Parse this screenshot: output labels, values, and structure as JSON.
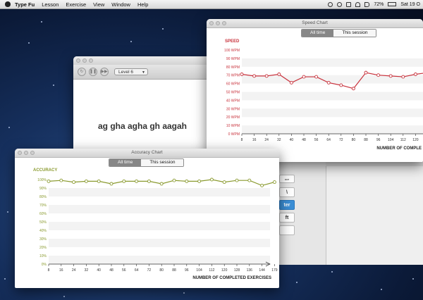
{
  "menubar": {
    "app_name": "Type Fu",
    "items": [
      "Lesson",
      "Exercise",
      "View",
      "Window",
      "Help"
    ],
    "battery": "72%",
    "clock": "Sat 19 O"
  },
  "main_window": {
    "level": "Level 6",
    "exercise_text": "ag gha agha gh aagah"
  },
  "keyboard": {
    "keys": [
      "\\",
      "ter",
      "ft"
    ],
    "top_label": "ace"
  },
  "speed_chart": {
    "window_title": "Speed Chart",
    "tabs": [
      "All time",
      "This session"
    ],
    "chart_data": {
      "type": "line",
      "title": "SPEED",
      "xlabel": "NUMBER OF COMPLE",
      "ylabel": "",
      "x": [
        8,
        16,
        24,
        32,
        40,
        48,
        56,
        64,
        72,
        80,
        88,
        96,
        104,
        112,
        120,
        128
      ],
      "series": [
        {
          "values": [
            71,
            69,
            69,
            71,
            61,
            68,
            68,
            61,
            58,
            54,
            73,
            70,
            69,
            68,
            71,
            73
          ]
        }
      ],
      "ylim": [
        0,
        100
      ],
      "yticks": [
        "0 WPM",
        "10 WPM",
        "20 WPM",
        "30 WPM",
        "40 WPM",
        "50 WPM",
        "60 WPM",
        "70 WPM",
        "80 WPM",
        "90 WPM",
        "100 WPM"
      ],
      "color": "#c8323c"
    }
  },
  "accuracy_chart": {
    "window_title": "Accuracy Chart",
    "tabs": [
      "All time",
      "This session"
    ],
    "chart_data": {
      "type": "line",
      "title": "ACCURACY",
      "xlabel": "NUMBER OF COMPLETED EXERCISES",
      "ylabel": "",
      "x": [
        8,
        16,
        24,
        32,
        40,
        48,
        56,
        64,
        72,
        80,
        88,
        96,
        104,
        112,
        120,
        128,
        136,
        144,
        179
      ],
      "series": [
        {
          "values": [
            98,
            99,
            97,
            98,
            98,
            95,
            98,
            98,
            98,
            95,
            99,
            98,
            98,
            100,
            97,
            99,
            99,
            93,
            97
          ]
        }
      ],
      "ylim": [
        0,
        100
      ],
      "yticks": [
        "0%",
        "10%",
        "20%",
        "30%",
        "40%",
        "50%",
        "60%",
        "70%",
        "80%",
        "90%",
        "100%"
      ],
      "xticks": [
        "8",
        "16",
        "24",
        "32",
        "40",
        "48",
        "56",
        "64",
        "72",
        "80",
        "88",
        "96",
        "104",
        "112",
        "120",
        "128",
        "136",
        "144",
        "179"
      ],
      "color": "#8a9a2e"
    }
  }
}
